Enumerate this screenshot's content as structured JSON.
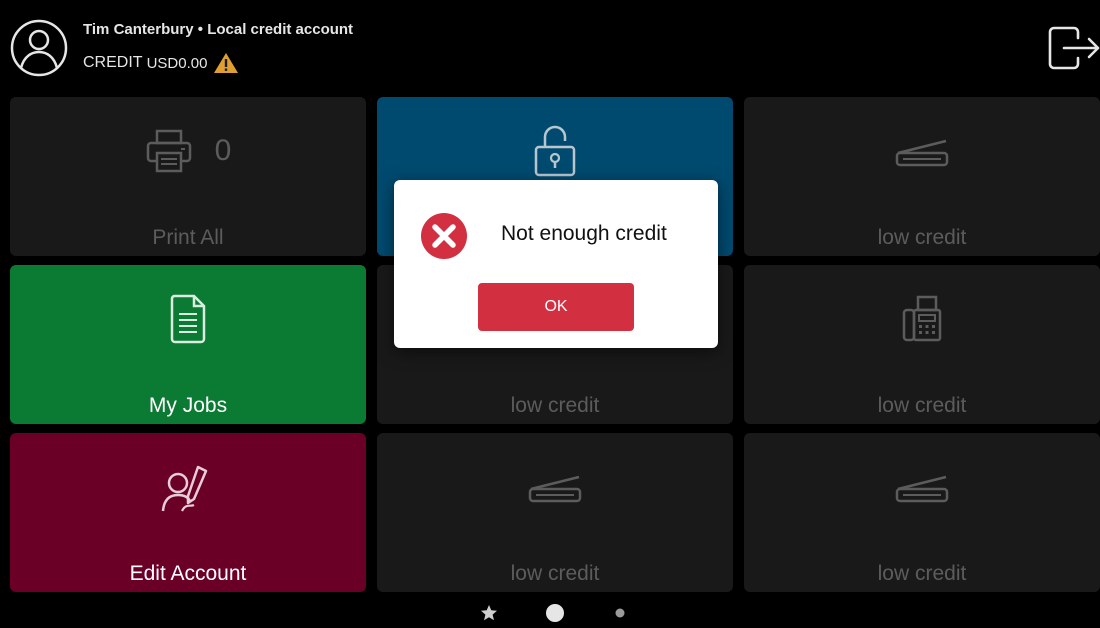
{
  "header": {
    "user_name": "Tim Canterbury",
    "separator": " • ",
    "account_type": "Local credit account",
    "credit_label": "CREDIT",
    "credit_amount": "USD0.00"
  },
  "tiles": [
    {
      "label": "Print All",
      "icon": "printer-icon",
      "count": "0",
      "color": "#191919",
      "state": "disabled"
    },
    {
      "label": "",
      "icon": "padlock-unlocked-icon",
      "color": "#004a6f",
      "state": "active"
    },
    {
      "label": "low credit",
      "icon": "scanner-icon",
      "color": "#191919",
      "state": "disabled"
    },
    {
      "label": "My Jobs",
      "icon": "document-icon",
      "color": "#0b7a33",
      "state": "active"
    },
    {
      "label": "low credit",
      "icon": "scanner-icon",
      "color": "#191919",
      "state": "disabled"
    },
    {
      "label": "low credit",
      "icon": "fax-icon",
      "color": "#191919",
      "state": "disabled"
    },
    {
      "label": "Edit Account",
      "icon": "user-edit-icon",
      "color": "#6b0027",
      "state": "active"
    },
    {
      "label": "low credit",
      "icon": "scanner-icon",
      "color": "#191919",
      "state": "disabled"
    },
    {
      "label": "low credit",
      "icon": "scanner-icon",
      "color": "#191919",
      "state": "disabled"
    }
  ],
  "dialog": {
    "message": "Not enough credit",
    "ok_label": "OK",
    "icon": "error-x-icon"
  },
  "pager": {
    "current_page": 1,
    "total_pages": 2,
    "favorites_icon": "star-icon"
  },
  "colors": {
    "accent_blue": "#004a6f",
    "accent_green": "#0b7a33",
    "accent_red": "#6b0027",
    "button_red": "#d22f40",
    "warning": "#e0a030"
  }
}
